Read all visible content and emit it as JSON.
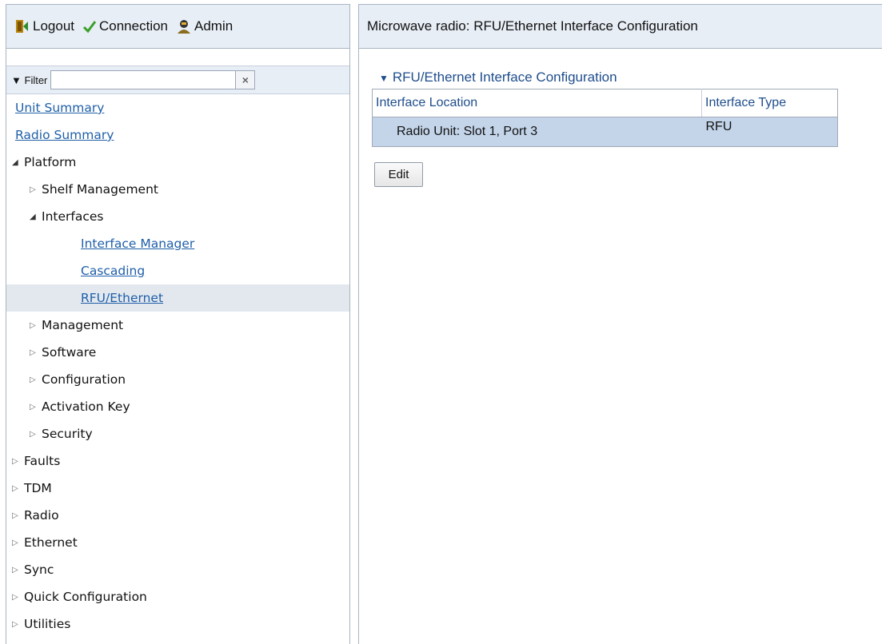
{
  "nav_header": {
    "logout_label": "Logout",
    "connection_label": "Connection",
    "admin_label": "Admin"
  },
  "filter": {
    "label": "Filter",
    "value": "",
    "clear_symbol": "×"
  },
  "tree": {
    "unit_summary": "Unit Summary",
    "radio_summary": "Radio Summary",
    "platform": "Platform",
    "shelf_management": "Shelf Management",
    "interfaces": "Interfaces",
    "interface_manager": "Interface Manager",
    "cascading": "Cascading",
    "rfu_ethernet": "RFU/Ethernet",
    "management": "Management",
    "software": "Software",
    "configuration": "Configuration",
    "activation_key": "Activation Key",
    "security": "Security",
    "faults": "Faults",
    "tdm": "TDM",
    "radio": "Radio",
    "ethernet": "Ethernet",
    "sync": "Sync",
    "quick_configuration": "Quick Configuration",
    "utilities": "Utilities"
  },
  "page": {
    "title": "Microwave radio: RFU/Ethernet Interface Configuration",
    "section_title": "RFU/Ethernet Interface Configuration",
    "table": {
      "headers": [
        "Interface Location",
        "Interface Type"
      ],
      "rows": [
        [
          "Radio Unit: Slot 1, Port 3",
          "RFU"
        ]
      ]
    },
    "edit_label": "Edit"
  },
  "colors": {
    "header_bg": "#e8eef6",
    "link": "#1f5fa8",
    "selected_row": "#c4d5ea",
    "selected_nav": "#e3e8ef"
  }
}
